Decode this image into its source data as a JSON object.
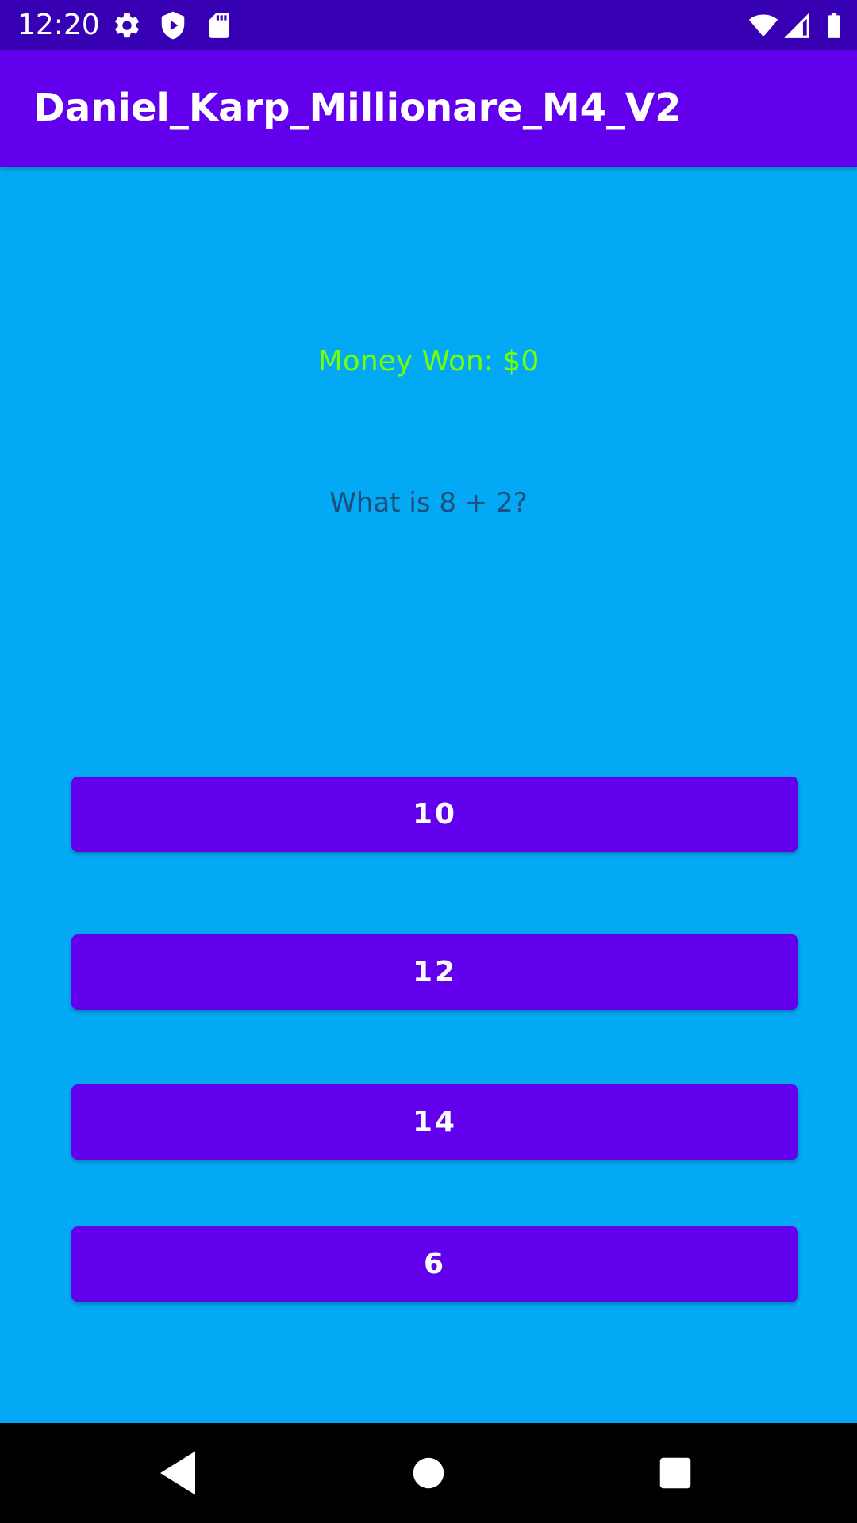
{
  "status_bar": {
    "time": "12:20",
    "background": "#3700B3",
    "icons": [
      "settings-icon",
      "shield-icon",
      "sd-card-icon",
      "wifi-icon",
      "signal-icon",
      "battery-icon"
    ]
  },
  "app_bar": {
    "title": "Daniel_Karp_Millionare_M4_V2",
    "background": "#6200EE"
  },
  "main": {
    "background": "#03A9F4",
    "money_won": "Money Won: $0",
    "money_color": "#76FF03",
    "question": "What is 8 + 2?"
  },
  "answers": [
    {
      "label": "10"
    },
    {
      "label": "12"
    },
    {
      "label": "14"
    },
    {
      "label": "6"
    }
  ],
  "nav_bar": {
    "icons": [
      "back-icon",
      "home-icon",
      "recents-icon"
    ]
  }
}
